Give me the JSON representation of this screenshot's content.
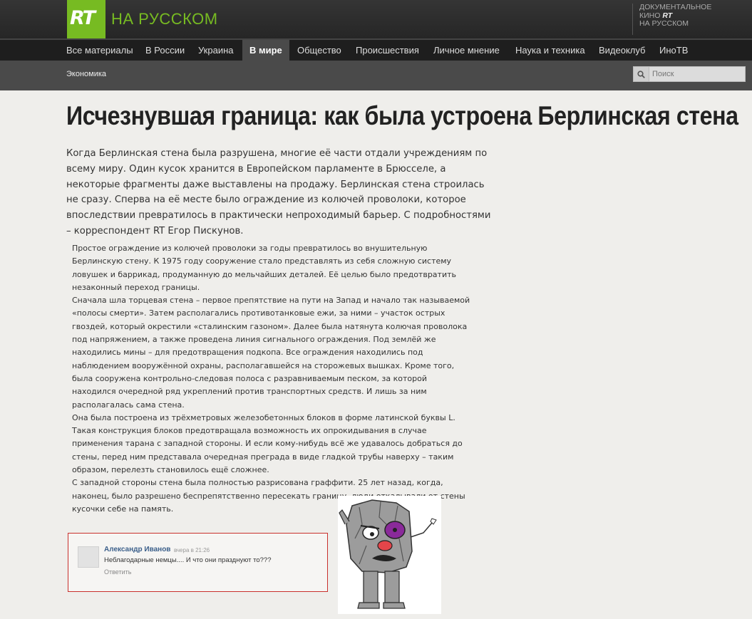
{
  "header": {
    "logo_mark": "RT",
    "logo_text": "НА РУССКОМ",
    "docs_line1": "ДОКУМЕНТАЛЬНОЕ",
    "docs_line2_prefix": "КИНО",
    "docs_line2_mark": "RT",
    "docs_line3": "НА РУССКОМ"
  },
  "nav": {
    "items": [
      "Все материалы",
      "В России",
      "Украина",
      "В мире",
      "Общество",
      "Происшествия",
      "Личное мнение",
      "Наука и техника",
      "Видеоклуб",
      "ИноТВ"
    ],
    "active": "В мире"
  },
  "subnav": {
    "item": "Экономика",
    "search_placeholder": "Поиск"
  },
  "article": {
    "title": "Исчезнувшая граница: как была устроена Берлинская стена",
    "lead": "Когда Берлинская стена была разрушена, многие её части отдали учреждениям по всему миру. Один кусок хранится в Европейском парламенте в Брюсселе, а некоторые фрагменты даже выставлены на продажу. Берлинская стена строилась не сразу. Сперва на её месте было ограждение из колючей проволоки, которое впоследствии превратилось в практически непроходимый барьер. С подробностями – корреспондент RT Егор Пискунов.",
    "paragraphs": [
      "Простое ограждение из колючей проволоки за годы превратилось во внушительную Берлинскую стену. К 1975 году сооружение стало представлять из себя сложную систему ловушек и баррикад, продуманную до мельчайших деталей. Её целью было предотвратить незаконный переход границы.",
      "Сначала шла торцевая стена – первое препятствие на пути на Запад и начало так называемой «полосы смерти». Затем располагались противотанковые ежи, за ними – участок острых гвоздей, который окрестили «сталинским газоном». Далее была натянута колючая проволока под напряжением, а также проведена линия сигнального ограждения. Под землёй же находились мины – для предотвращения подкопа. Все ограждения находились под наблюдением вооружённой охраны, располагавшейся на сторожевых вышках. Кроме того, была сооружена контрольно-следовая полоса с разравниваемым песком, за которой находился очередной ряд укреплений против транспортных средств. И лишь за ним располагалась сама стена.",
      "Она была построена из трёхметровых железобетонных блоков в форме латинской буквы L. Такая конструкция блоков предотвращала возможность их опрокидывания в случае применения тарана с западной стороны. И если кому-нибудь всё же удавалось добраться до стены, перед ним представала очередная преграда в виде гладкой трубы наверху – таким образом, перелезть становилось ещё сложнее.",
      "С западной стороны стена была полностью разрисована граффити. 25 лет назад, когда, наконец, было разрешено беспрепятственно пересекать границу, люди откалывали от стены кусочки себе на память."
    ]
  },
  "comment": {
    "author": "Александр Иванов",
    "time": "вчера в 21:26",
    "text": "Неблагодарные немцы.... И что они празднуют то???",
    "reply_label": "Ответить"
  },
  "colors": {
    "brand_green": "#77bb22",
    "comment_border": "#c9302c",
    "author_link": "#3b5f8a"
  }
}
